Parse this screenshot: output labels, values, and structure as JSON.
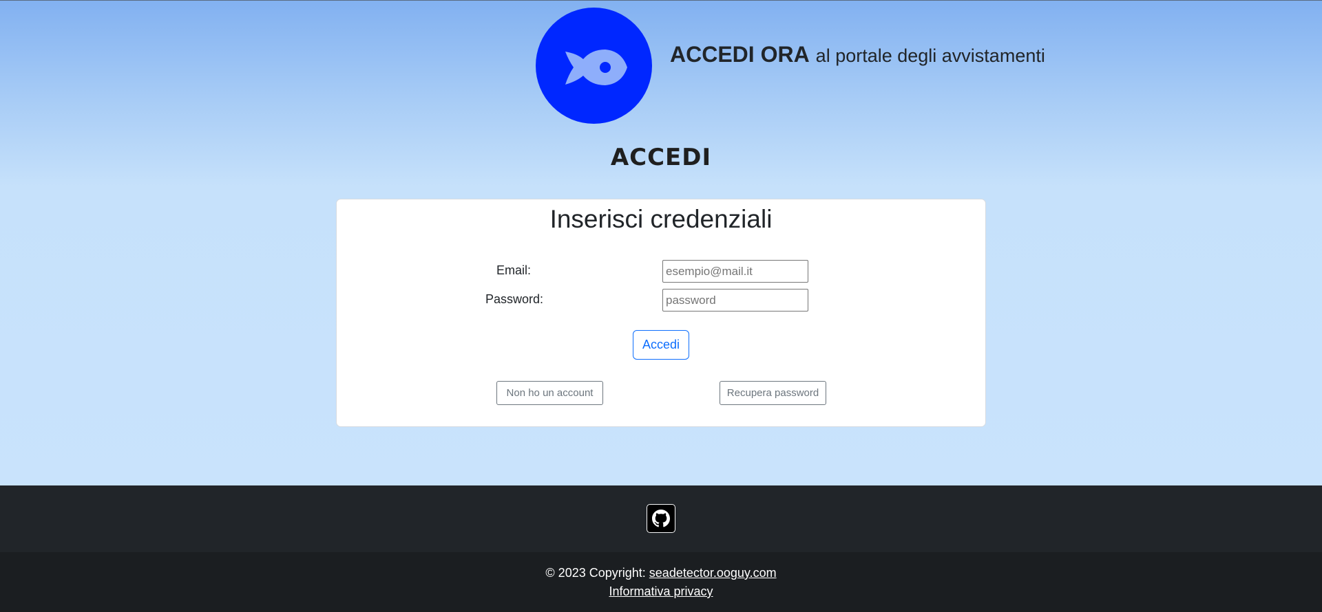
{
  "header": {
    "headline_strong": "ACCEDI ORA",
    "headline_rest": "al portale degli avvistamenti",
    "logo_icon": "fish-icon",
    "logo_color": "#0027ff"
  },
  "page": {
    "title": "ACCEDI"
  },
  "login_card": {
    "title": "Inserisci credenziali",
    "email_label": "Email:",
    "email_placeholder": "esempio@mail.it",
    "email_value": "",
    "password_label": "Password:",
    "password_placeholder": "password",
    "password_value": "",
    "submit_label": "Accedi",
    "no_account_label": "Non ho un account",
    "recover_label": "Recupera password"
  },
  "footer": {
    "github_icon": "github-icon",
    "copyright_prefix": "© 2023 Copyright:",
    "site_link": "seadetector.ooguy.com",
    "privacy_link": "Informativa privacy"
  },
  "colors": {
    "accent": "#0d6efd",
    "footer_dark": "#212529",
    "footer_darker": "#1b1e21"
  }
}
